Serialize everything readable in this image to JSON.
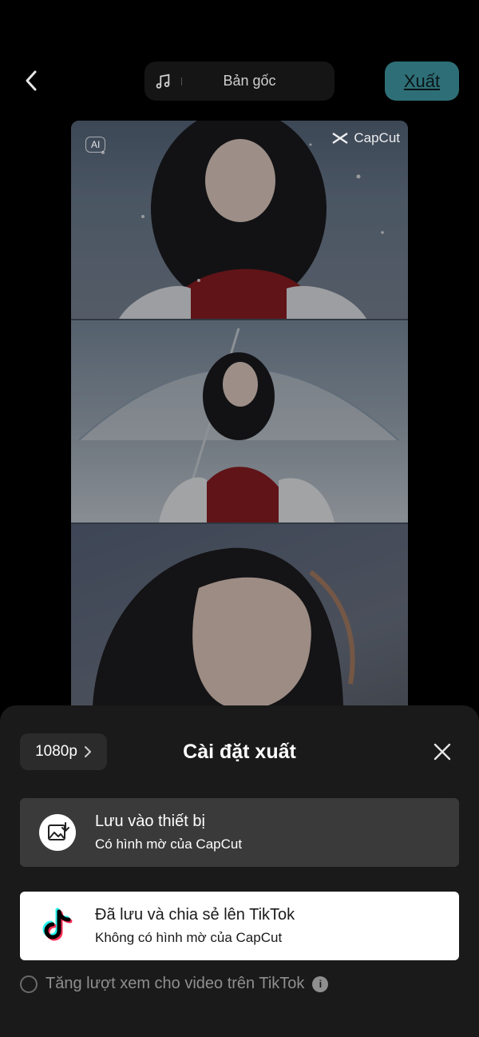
{
  "header": {
    "sound_label": "Bản gốc",
    "export_label": "Xuất"
  },
  "preview": {
    "ai_badge": "AI",
    "watermark": "CapCut"
  },
  "sheet": {
    "resolution": "1080p",
    "title": "Cài đặt xuất",
    "options": [
      {
        "title": "Lưu vào thiết bị",
        "subtitle": "Có hình mờ của CapCut"
      },
      {
        "title": "Đã lưu và chia sẻ lên TikTok",
        "subtitle": "Không có hình mờ của CapCut"
      }
    ],
    "boost_label": "Tăng lượt xem cho video trên TikTok"
  },
  "colors": {
    "accent": "#2e6f77",
    "sheet_bg": "#1a1a1a",
    "tiktok_cyan": "#25f4ee",
    "tiktok_red": "#fe2c55"
  }
}
